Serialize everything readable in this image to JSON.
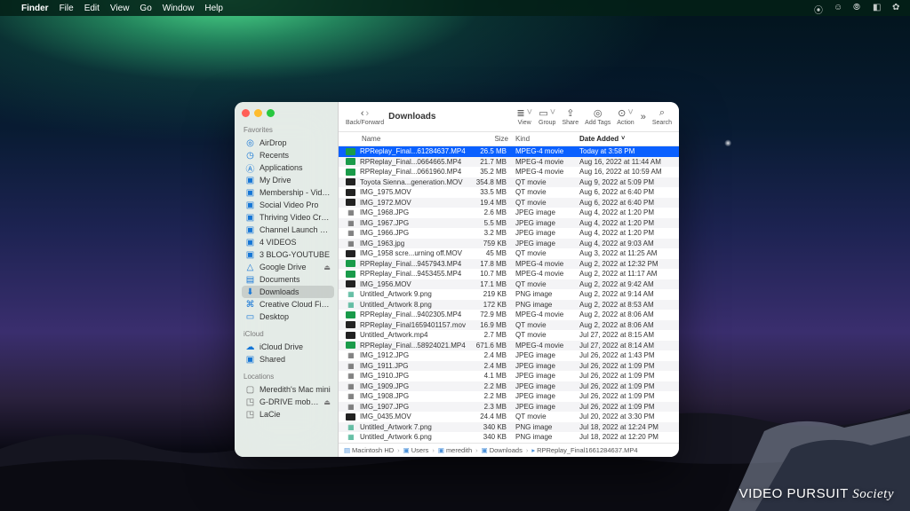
{
  "menubar": {
    "app": "Finder",
    "items": [
      "File",
      "Edit",
      "View",
      "Go",
      "Window",
      "Help"
    ]
  },
  "window": {
    "title": "Downloads",
    "toolbar": {
      "back_forward": "Back/Forward",
      "view": "View",
      "group": "Group",
      "share": "Share",
      "tags": "Add Tags",
      "action": "Action",
      "search": "Search"
    },
    "columns": {
      "name": "Name",
      "size": "Size",
      "kind": "Kind",
      "date": "Date Added"
    }
  },
  "sidebar": {
    "favorites_label": "Favorites",
    "icloud_label": "iCloud",
    "locations_label": "Locations",
    "favorites": [
      {
        "icon": "airdrop",
        "label": "AirDrop"
      },
      {
        "icon": "clock",
        "label": "Recents"
      },
      {
        "icon": "app",
        "label": "Applications"
      },
      {
        "icon": "folder",
        "label": "My Drive"
      },
      {
        "icon": "folder",
        "label": "Membership - Video Pursuit So..."
      },
      {
        "icon": "folder",
        "label": "Social Video Pro"
      },
      {
        "icon": "folder",
        "label": "Thriving Video Creator Camp"
      },
      {
        "icon": "folder",
        "label": "Channel Launch Statup"
      },
      {
        "icon": "folder",
        "label": "4 VIDEOS"
      },
      {
        "icon": "folder",
        "label": "3 BLOG-YOUTUBE"
      },
      {
        "icon": "gdrive",
        "label": "Google Drive",
        "eject": true
      },
      {
        "icon": "doc",
        "label": "Documents"
      },
      {
        "icon": "down",
        "label": "Downloads",
        "selected": true
      },
      {
        "icon": "cc",
        "label": "Creative Cloud Files"
      },
      {
        "icon": "desktop",
        "label": "Desktop"
      }
    ],
    "icloud": [
      {
        "icon": "cloud",
        "label": "iCloud Drive"
      },
      {
        "icon": "shared",
        "label": "Shared"
      }
    ],
    "locations": [
      {
        "icon": "mac",
        "label": "Meredith's Mac mini"
      },
      {
        "icon": "disk",
        "label": "G-DRIVE mobile USB-C",
        "eject": true
      },
      {
        "icon": "disk",
        "label": "LaCie"
      }
    ]
  },
  "files": [
    {
      "i": "mp4",
      "n": "RPReplay_Final...61284637.MP4",
      "s": "26.5 MB",
      "k": "MPEG-4 movie",
      "d": "Today at 3:58 PM",
      "sel": true
    },
    {
      "i": "mp4",
      "n": "RPReplay_Final...0664665.MP4",
      "s": "21.7 MB",
      "k": "MPEG-4 movie",
      "d": "Aug 16, 2022 at 11:44 AM"
    },
    {
      "i": "mp4",
      "n": "RPReplay_Final...0661960.MP4",
      "s": "35.2 MB",
      "k": "MPEG-4 movie",
      "d": "Aug 16, 2022 at 10:59 AM"
    },
    {
      "i": "mov",
      "n": "Toyota Sienna...generation.MOV",
      "s": "354.8 MB",
      "k": "QT movie",
      "d": "Aug 9, 2022 at 5:09 PM"
    },
    {
      "i": "mov",
      "n": "IMG_1975.MOV",
      "s": "33.5 MB",
      "k": "QT movie",
      "d": "Aug 6, 2022 at 6:40 PM"
    },
    {
      "i": "mov",
      "n": "IMG_1972.MOV",
      "s": "19.4 MB",
      "k": "QT movie",
      "d": "Aug 6, 2022 at 6:40 PM"
    },
    {
      "i": "jpg",
      "n": "IMG_1968.JPG",
      "s": "2.6 MB",
      "k": "JPEG image",
      "d": "Aug 4, 2022 at 1:20 PM"
    },
    {
      "i": "jpg",
      "n": "IMG_1967.JPG",
      "s": "5.5 MB",
      "k": "JPEG image",
      "d": "Aug 4, 2022 at 1:20 PM"
    },
    {
      "i": "jpg",
      "n": "IMG_1966.JPG",
      "s": "3.2 MB",
      "k": "JPEG image",
      "d": "Aug 4, 2022 at 1:20 PM"
    },
    {
      "i": "jpg",
      "n": "IMG_1963.jpg",
      "s": "759 KB",
      "k": "JPEG image",
      "d": "Aug 4, 2022 at 9:03 AM"
    },
    {
      "i": "mov",
      "n": "IMG_1958 scre...urning off.MOV",
      "s": "45 MB",
      "k": "QT movie",
      "d": "Aug 3, 2022 at 11:25 AM"
    },
    {
      "i": "mp4",
      "n": "RPReplay_Final...9457943.MP4",
      "s": "17.8 MB",
      "k": "MPEG-4 movie",
      "d": "Aug 2, 2022 at 12:32 PM"
    },
    {
      "i": "mp4",
      "n": "RPReplay_Final...9453455.MP4",
      "s": "10.7 MB",
      "k": "MPEG-4 movie",
      "d": "Aug 2, 2022 at 11:17 AM"
    },
    {
      "i": "mov",
      "n": "IMG_1956.MOV",
      "s": "17.1 MB",
      "k": "QT movie",
      "d": "Aug 2, 2022 at 9:42 AM"
    },
    {
      "i": "png",
      "n": "Untitled_Artwork 9.png",
      "s": "219 KB",
      "k": "PNG image",
      "d": "Aug 2, 2022 at 9:14 AM"
    },
    {
      "i": "png",
      "n": "Untitled_Artwork 8.png",
      "s": "172 KB",
      "k": "PNG image",
      "d": "Aug 2, 2022 at 8:53 AM"
    },
    {
      "i": "mp4",
      "n": "RPReplay_Final...9402305.MP4",
      "s": "72.9 MB",
      "k": "MPEG-4 movie",
      "d": "Aug 2, 2022 at 8:06 AM"
    },
    {
      "i": "mov",
      "n": "RPReplay_Final1659401157.mov",
      "s": "16.9 MB",
      "k": "QT movie",
      "d": "Aug 2, 2022 at 8:06 AM"
    },
    {
      "i": "mov",
      "n": "Untitled_Artwork.mp4",
      "s": "2.7 MB",
      "k": "QT movie",
      "d": "Jul 27, 2022 at 8:15 AM"
    },
    {
      "i": "mp4",
      "n": "RPReplay_Final...58924021.MP4",
      "s": "671.6 MB",
      "k": "MPEG-4 movie",
      "d": "Jul 27, 2022 at 8:14 AM"
    },
    {
      "i": "jpg",
      "n": "IMG_1912.JPG",
      "s": "2.4 MB",
      "k": "JPEG image",
      "d": "Jul 26, 2022 at 1:43 PM"
    },
    {
      "i": "jpg",
      "n": "IMG_1911.JPG",
      "s": "2.4 MB",
      "k": "JPEG image",
      "d": "Jul 26, 2022 at 1:09 PM"
    },
    {
      "i": "jpg",
      "n": "IMG_1910.JPG",
      "s": "4.1 MB",
      "k": "JPEG image",
      "d": "Jul 26, 2022 at 1:09 PM"
    },
    {
      "i": "jpg",
      "n": "IMG_1909.JPG",
      "s": "2.2 MB",
      "k": "JPEG image",
      "d": "Jul 26, 2022 at 1:09 PM"
    },
    {
      "i": "jpg",
      "n": "IMG_1908.JPG",
      "s": "2.2 MB",
      "k": "JPEG image",
      "d": "Jul 26, 2022 at 1:09 PM"
    },
    {
      "i": "jpg",
      "n": "IMG_1907.JPG",
      "s": "2.3 MB",
      "k": "JPEG image",
      "d": "Jul 26, 2022 at 1:09 PM"
    },
    {
      "i": "mov",
      "n": "IMG_0435.MOV",
      "s": "24.4 MB",
      "k": "QT movie",
      "d": "Jul 20, 2022 at 3:30 PM"
    },
    {
      "i": "png",
      "n": "Untitled_Artwork 7.png",
      "s": "340 KB",
      "k": "PNG image",
      "d": "Jul 18, 2022 at 12:24 PM"
    },
    {
      "i": "png",
      "n": "Untitled_Artwork 6.png",
      "s": "340 KB",
      "k": "PNG image",
      "d": "Jul 18, 2022 at 12:20 PM"
    }
  ],
  "path": [
    "Macintosh HD",
    "Users",
    "meredith",
    "Downloads",
    "RPReplay_Final1661284637.MP4"
  ],
  "watermark": {
    "a": "VIDEO PURSUIT",
    "b": "Society"
  }
}
